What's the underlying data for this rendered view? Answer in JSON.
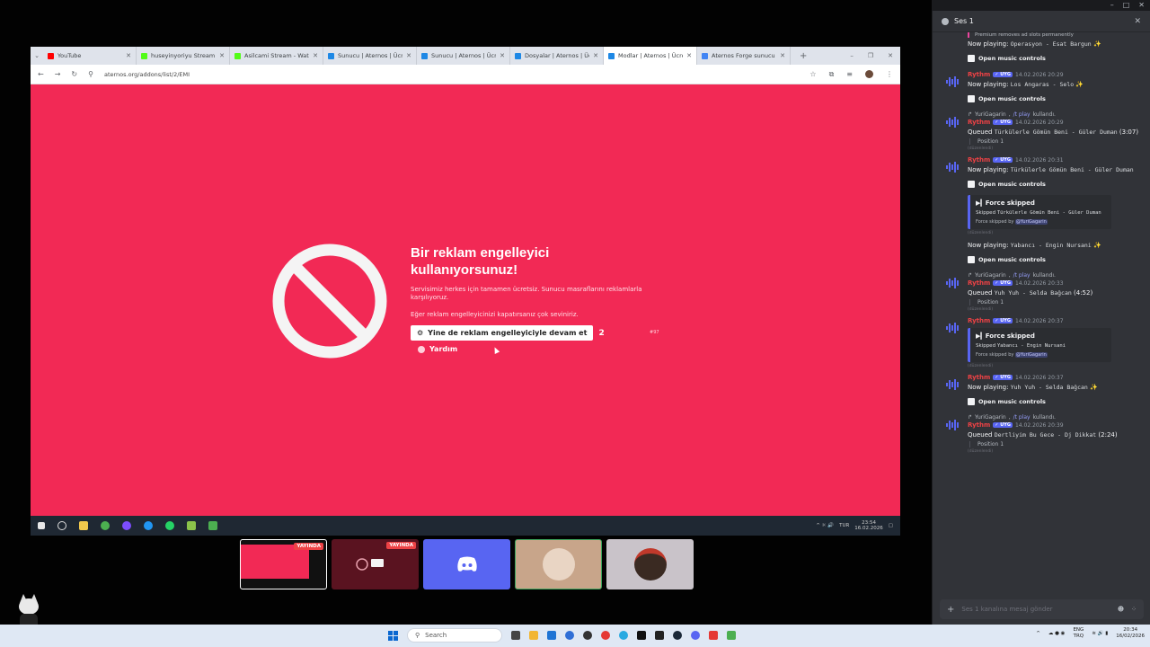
{
  "window": {
    "controls": [
      "–",
      "□",
      "✕"
    ]
  },
  "browser": {
    "tabs": [
      {
        "title": "YouTube",
        "color": "#ff0000",
        "active": false
      },
      {
        "title": "huseyinyoriyu Stream - Kick",
        "color": "#53fc18",
        "active": false
      },
      {
        "title": "Asilcami Stream - Watch",
        "color": "#53fc18",
        "active": false
      },
      {
        "title": "Sunucu | Aternos | Ücretsiz",
        "color": "#1e88e5",
        "active": false
      },
      {
        "title": "Sunucu | Aternos | Ücretsiz",
        "color": "#1e88e5",
        "active": false
      },
      {
        "title": "Dosyalar | Aternos | Ücretsiz",
        "color": "#1e88e5",
        "active": false
      },
      {
        "title": "Modlar | Aternos | Ücretsiz",
        "color": "#1e88e5",
        "active": true
      },
      {
        "title": "Aternos Forge sunucu ha",
        "color": "#4285f4",
        "active": false
      }
    ],
    "new_tab": "+",
    "url": "aternos.org/addons/list/2/EMI",
    "page": {
      "title": "Bir reklam engelleyici kullanıyorsunuz!",
      "p1": "Servisimiz herkes için tamamen ücretsiz. Sunucu masraflarını reklamlarla karşılıyoruz.",
      "p2": "Eğer reklam engelleyicinizi kapatırsanız çok seviniriz.",
      "continue_label": "Yine de reklam engelleyiciyle devam et",
      "continue_count": "2",
      "help_label": "Yardım",
      "page_id": "#97"
    },
    "taskbar": {
      "lang": "TUR",
      "time": "23:54",
      "date": "16.02.2026"
    }
  },
  "tiles": [
    {
      "label": "YAYINDA",
      "kind": "stream"
    },
    {
      "label": "YAYINDA",
      "kind": "stream"
    },
    {
      "label": "",
      "kind": "discord"
    },
    {
      "label": "",
      "kind": "user"
    },
    {
      "label": "",
      "kind": "user"
    }
  ],
  "panel": {
    "title": "Ses 1",
    "input_placeholder": "Ses 1 kanalına mesaj gönder",
    "messages": [
      {
        "reply": "",
        "name": "",
        "time": "",
        "lines": [
          "Premium removes ad slots permanently"
        ],
        "np": "Operasyon - Esat Bargun",
        "ctrl": "Open music controls",
        "kind": "np-top"
      },
      {
        "name": "Rythm",
        "tag": "✓ UYG",
        "time": "14.02.2026 20:29",
        "np": "Los Angaras - Selo",
        "ctrl": "Open music controls",
        "kind": "np"
      },
      {
        "reply_user": "YuriGagarin",
        "reply_cmd": "/t play",
        "reply_tail": "kullandı.",
        "name": "Rythm",
        "tag": "✓ UYG",
        "time": "14.02.2026 20:29",
        "queued": "Türkülerle Gömün Beni - Güler Duman",
        "dur": "(3:07)",
        "pos": "Position 1",
        "edited": "(düzenlendi)",
        "kind": "queued"
      },
      {
        "name": "Rythm",
        "tag": "✓ UYG",
        "time": "14.02.2026 20:31",
        "np": "Türkülerle Gömün Beni - Güler Duman",
        "ctrl": "Open music controls",
        "embed_title": "Force skipped",
        "embed_desc": "Türkülerle Gömün Beni - Güler Duman",
        "embed_foot": "@YuriGagarin",
        "edited": "(düzenlendi)",
        "np2": "Yabancı - Engin Nursani",
        "kind": "np-skip"
      },
      {
        "reply_user": "YuriGagarin",
        "reply_cmd": "/t play",
        "reply_tail": "kullandı.",
        "name": "Rythm",
        "tag": "✓ UYG",
        "time": "14.02.2026 20:33",
        "queued": "Yuh Yuh - Selda Bağcan",
        "dur": "(4:52)",
        "pos": "Position 1",
        "edited": "(düzenlendi)",
        "kind": "queued"
      },
      {
        "name": "Rythm",
        "tag": "✓ UYG",
        "time": "14.02.2026 20:37",
        "embed_title": "Force skipped",
        "embed_desc": "Yabancı - Engin Nursani",
        "embed_foot": "@YuriGagarin",
        "edited": "(düzenlendi)",
        "kind": "skip"
      },
      {
        "name": "Rythm",
        "tag": "✓ UYG",
        "time": "14.02.2026 20:37",
        "np": "Yuh Yuh - Selda Bağcan",
        "ctrl": "Open music controls",
        "kind": "np"
      },
      {
        "reply_user": "YuriGagarin",
        "reply_cmd": "/t play",
        "reply_tail": "kullandı.",
        "name": "Rythm",
        "tag": "✓ UYG",
        "time": "14.02.2026 20:39",
        "queued": "Dertliyim Bu Gece - Dj Dikkat",
        "dur": "(2:24)",
        "pos": "Position 1",
        "edited": "(düzenlendi)",
        "kind": "queued"
      }
    ],
    "labels": {
      "now_playing": "Now playing:",
      "queued": "Queued",
      "skipped": "Skipped",
      "force_by": "Force skipped by"
    }
  },
  "os": {
    "search_placeholder": "Search",
    "lang": "ENG",
    "lang2": "TRQ",
    "time": "20:34",
    "date": "16/02/2026"
  }
}
